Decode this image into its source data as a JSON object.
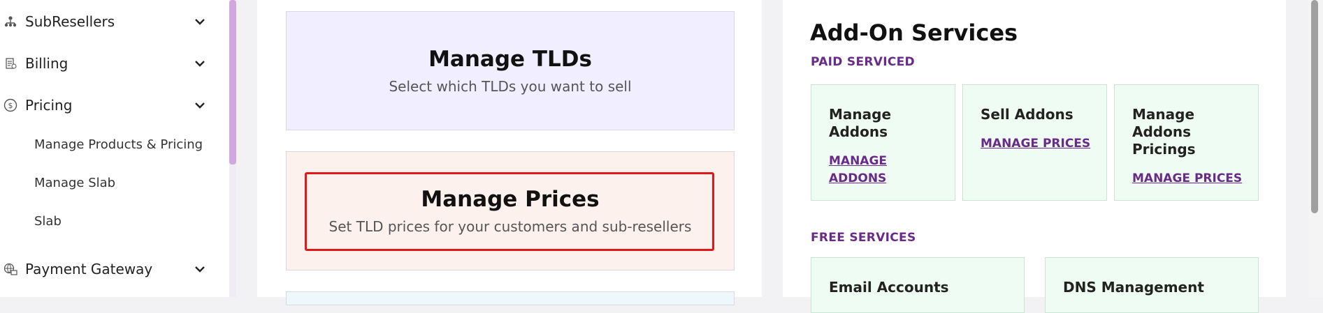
{
  "sidebar": {
    "items": [
      {
        "label": "SubResellers",
        "icon": "network-icon"
      },
      {
        "label": "Billing",
        "icon": "receipt-icon"
      },
      {
        "label": "Pricing",
        "icon": "dollar-circle-icon"
      },
      {
        "label": "Payment Gateway",
        "icon": "globe-card-icon"
      }
    ],
    "pricing_subitems": [
      "Manage Products & Pricing",
      "Manage Slab",
      "Slab"
    ]
  },
  "cards": {
    "tlds": {
      "title": "Manage TLDs",
      "subtitle": "Select which TLDs you want to sell"
    },
    "prices": {
      "title": "Manage Prices",
      "subtitle": "Set TLD prices for your customers and sub-resellers"
    }
  },
  "addons": {
    "title": "Add-On Services",
    "paid_label": "PAID SERVICED",
    "paid": [
      {
        "name": "Manage Addons",
        "link": "MANAGE ADDONS"
      },
      {
        "name": "Sell Addons",
        "link": "MANAGE PRICES"
      },
      {
        "name": "Manage Addons Pricings",
        "link": "MANAGE PRICES"
      }
    ],
    "free_label": "FREE SERVICES",
    "free": [
      {
        "name": "Email Accounts"
      },
      {
        "name": "DNS Management"
      }
    ]
  },
  "colors": {
    "accent": "#6a2a8a",
    "highlight": "#e01818",
    "tld_card_bg": "#f1efff",
    "prices_card_bg": "#fdf1ee",
    "addon_card_bg": "#effcf3"
  }
}
